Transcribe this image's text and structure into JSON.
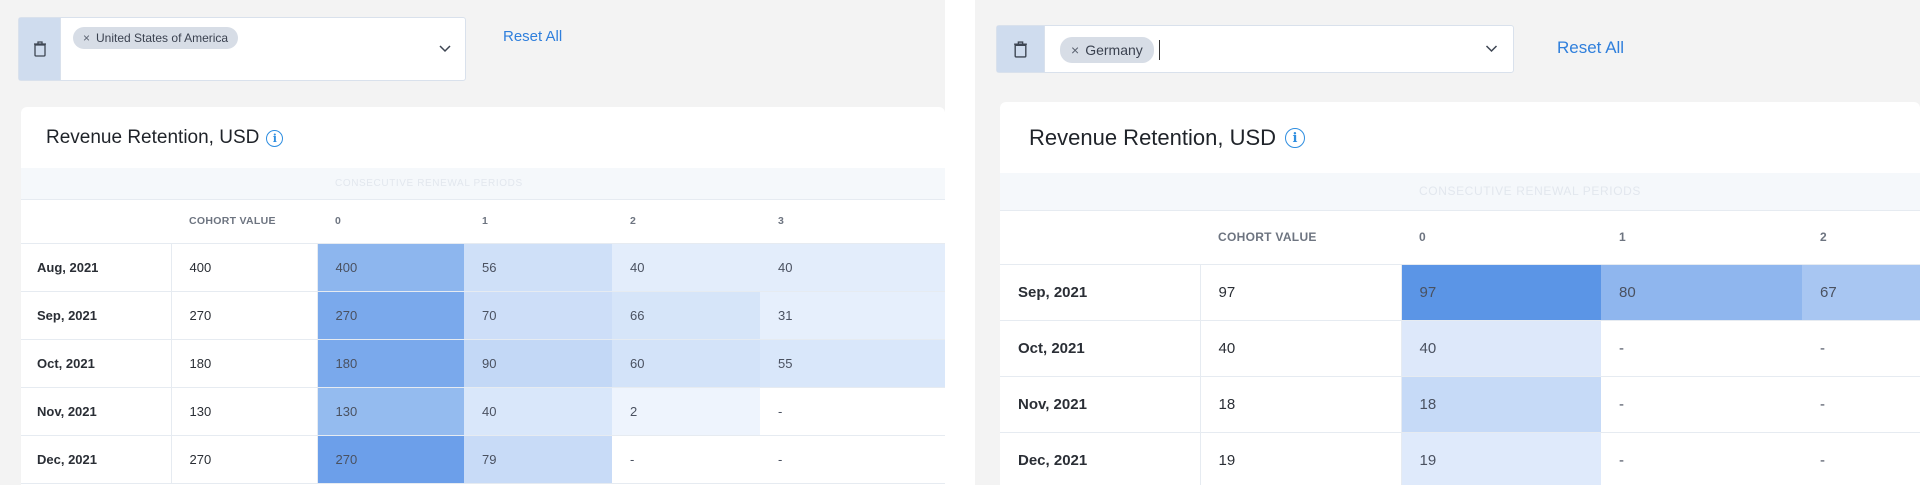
{
  "left": {
    "filter": {
      "chip_label": "United States of America"
    },
    "reset_label": "Reset All",
    "card_title": "Revenue Retention, USD",
    "super_header": "CONSECUTIVE RENEWAL PERIODS",
    "columns": [
      "",
      "COHORT VALUE",
      "0",
      "1",
      "2",
      "3"
    ],
    "rows": [
      {
        "label": "Aug, 2021",
        "value": "400",
        "cells": [
          "400",
          "56",
          "40",
          "40"
        ]
      },
      {
        "label": "Sep, 2021",
        "value": "270",
        "cells": [
          "270",
          "70",
          "66",
          "31"
        ]
      },
      {
        "label": "Oct, 2021",
        "value": "180",
        "cells": [
          "180",
          "90",
          "60",
          "55"
        ]
      },
      {
        "label": "Nov, 2021",
        "value": "130",
        "cells": [
          "130",
          "40",
          "2",
          "-"
        ]
      },
      {
        "label": "Dec, 2021",
        "value": "270",
        "cells": [
          "270",
          "79",
          "-",
          "-"
        ]
      }
    ],
    "cell_colors": [
      [
        "#8db6ee",
        "#cfe0f8",
        "#e3edfb",
        "#e3edfb"
      ],
      [
        "#7aa9ec",
        "#cddef8",
        "#d6e5f9",
        "#e6effc"
      ],
      [
        "#7aa9ec",
        "#c3d8f6",
        "#d3e3f9",
        "#d9e7fa"
      ],
      [
        "#94bbef",
        "#d9e7fa",
        "#eef4fd",
        "#ffffff"
      ],
      [
        "#6c9fea",
        "#c8dbf7",
        "#ffffff",
        "#ffffff"
      ]
    ]
  },
  "right": {
    "filter": {
      "chip_label": "Germany"
    },
    "reset_label": "Reset All",
    "card_title": "Revenue Retention, USD",
    "super_header": "CONSECUTIVE RENEWAL PERIODS",
    "columns": [
      "",
      "COHORT VALUE",
      "0",
      "1",
      "2"
    ],
    "rows": [
      {
        "label": "Sep, 2021",
        "value": "97",
        "cells": [
          "97",
          "80",
          "67"
        ]
      },
      {
        "label": "Oct, 2021",
        "value": "40",
        "cells": [
          "40",
          "-",
          "-"
        ]
      },
      {
        "label": "Nov, 2021",
        "value": "18",
        "cells": [
          "18",
          "-",
          "-"
        ]
      },
      {
        "label": "Dec, 2021",
        "value": "19",
        "cells": [
          "19",
          "-",
          "-"
        ]
      }
    ],
    "cell_colors": [
      [
        "#5b95e6",
        "#8fb6ee",
        "#a8c6f2"
      ],
      [
        "#dde8fa",
        "#ffffff",
        "#ffffff"
      ],
      [
        "#c6daf7",
        "#ffffff",
        "#ffffff"
      ],
      [
        "#dfeafb",
        "#ffffff",
        "#ffffff"
      ]
    ]
  },
  "icons": {
    "trash": "trash-icon",
    "caret": "chevron-down-icon",
    "remove": "close-icon",
    "info": "info-icon"
  }
}
